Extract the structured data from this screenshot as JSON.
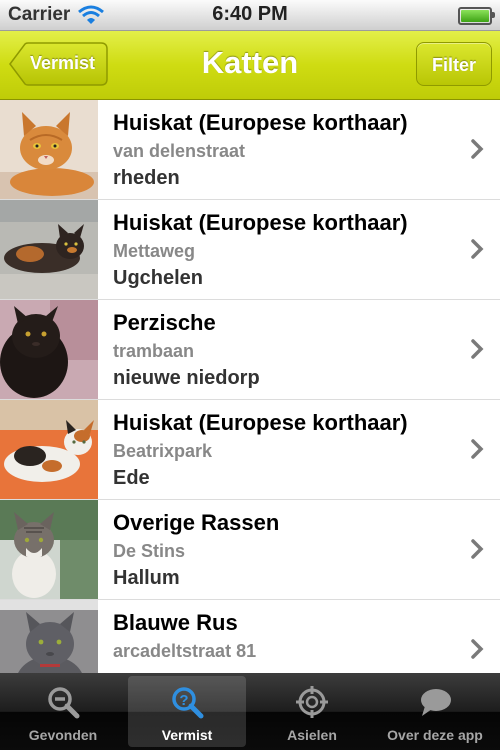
{
  "status_bar": {
    "carrier": "Carrier",
    "time": "6:40 PM"
  },
  "nav": {
    "back_label": "Vermist",
    "title": "Katten",
    "filter_label": "Filter"
  },
  "colors": {
    "accent": "#cfdc12",
    "tab_active": "#2f8fe0"
  },
  "items": [
    {
      "title": "Huiskat (Europese korthaar)",
      "street": "van delenstraat",
      "city": "rheden",
      "photo": "ginger-cat-photo"
    },
    {
      "title": "Huiskat (Europese korthaar)",
      "street": "Mettaweg",
      "city": "Ugchelen",
      "photo": "tortoiseshell-cat-photo"
    },
    {
      "title": "Perzische",
      "street": "trambaan",
      "city": "nieuwe niedorp",
      "photo": "black-persian-cat-photo"
    },
    {
      "title": "Huiskat (Europese korthaar)",
      "street": "Beatrixpark",
      "city": "Ede",
      "photo": "calico-cat-photo"
    },
    {
      "title": "Overige Rassen",
      "street": "De Stins",
      "city": "Hallum",
      "photo": "tabby-white-cat-photo"
    },
    {
      "title": "Blauwe Rus",
      "street": "arcadeltstraat 81",
      "city": "",
      "photo": "grey-cat-photo"
    }
  ],
  "tabs": [
    {
      "label": "Gevonden",
      "icon": "magnifier-minus-icon",
      "active": false
    },
    {
      "label": "Vermist",
      "icon": "magnifier-question-icon",
      "active": true
    },
    {
      "label": "Asielen",
      "icon": "crosshair-icon",
      "active": false
    },
    {
      "label": "Over deze app",
      "icon": "speech-bubble-icon",
      "active": false
    }
  ]
}
